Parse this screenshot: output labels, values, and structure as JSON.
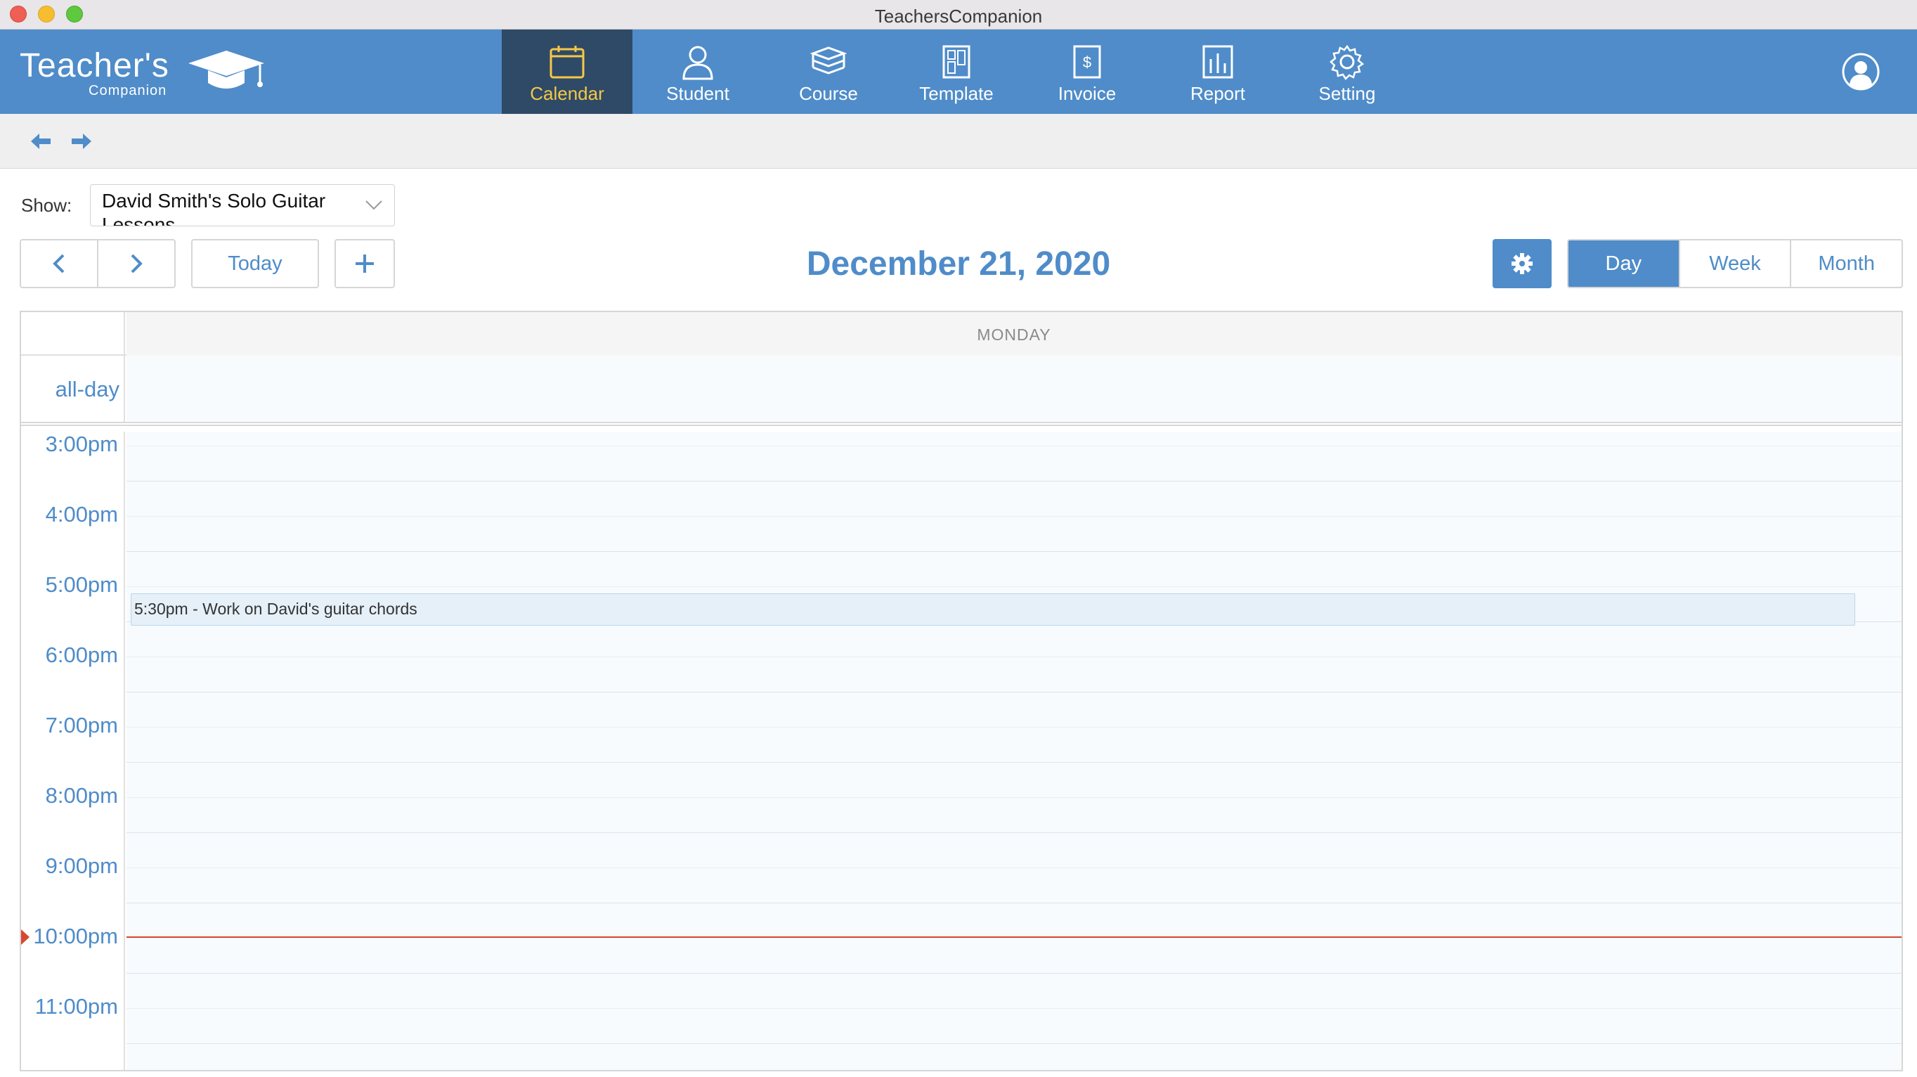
{
  "window": {
    "title": "TeachersCompanion"
  },
  "brand": {
    "name": "Teacher's",
    "sub": "Companion"
  },
  "nav": {
    "items": [
      {
        "label": "Calendar",
        "icon": "calendar-icon",
        "active": true
      },
      {
        "label": "Student",
        "icon": "person-icon",
        "active": false
      },
      {
        "label": "Course",
        "icon": "books-icon",
        "active": false
      },
      {
        "label": "Template",
        "icon": "template-icon",
        "active": false
      },
      {
        "label": "Invoice",
        "icon": "invoice-icon",
        "active": false
      },
      {
        "label": "Report",
        "icon": "bar-chart-icon",
        "active": false
      },
      {
        "label": "Setting",
        "icon": "gear-icon",
        "active": false
      }
    ],
    "profile_icon": "user-circle-icon"
  },
  "toolbar": {
    "back_icon": "arrow-left-icon",
    "forward_icon": "arrow-right-icon"
  },
  "filter": {
    "show_label": "Show:",
    "selected": "David Smith's Solo Guitar Lessons"
  },
  "controls": {
    "today_label": "Today",
    "date_title": "December 21, 2020",
    "views": [
      {
        "label": "Day",
        "active": true
      },
      {
        "label": "Week",
        "active": false
      },
      {
        "label": "Month",
        "active": false
      }
    ]
  },
  "calendar": {
    "day_header": "MONDAY",
    "all_day_label": "all-day",
    "hours": [
      "3:00pm",
      "4:00pm",
      "5:00pm",
      "6:00pm",
      "7:00pm",
      "8:00pm",
      "9:00pm",
      "10:00pm",
      "11:00pm"
    ],
    "events": [
      {
        "text": "5:30pm - Work on David's guitar chords"
      }
    ],
    "current_time": "10:00pm"
  },
  "colors": {
    "accent": "#4f8cc9",
    "nav_active_bg": "#2f4a66",
    "nav_active_text": "#f6c847",
    "now_line": "#d9482e"
  }
}
